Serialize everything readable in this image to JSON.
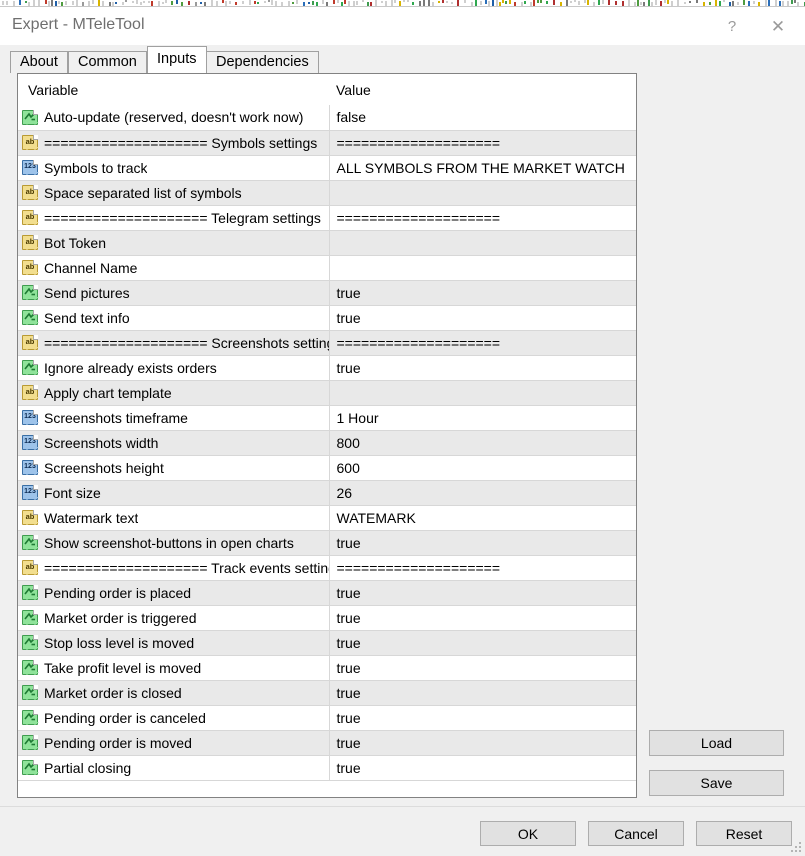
{
  "window": {
    "title": "Expert - MTeleTool",
    "help_label": "?",
    "close_label": "✕"
  },
  "tabs": [
    {
      "label": "About",
      "active": false
    },
    {
      "label": "Common",
      "active": false
    },
    {
      "label": "Inputs",
      "active": true
    },
    {
      "label": "Dependencies",
      "active": false
    }
  ],
  "table": {
    "headers": {
      "variable": "Variable",
      "value": "Value"
    },
    "rows": [
      {
        "icon": "bool-icon",
        "variable": "Auto-update (reserved, doesn't work now)",
        "value": "false"
      },
      {
        "icon": "string-icon",
        "variable": "==================== Symbols settings",
        "value": "===================="
      },
      {
        "icon": "int-icon",
        "variable": "Symbols to track",
        "value": "ALL SYMBOLS FROM THE MARKET WATCH"
      },
      {
        "icon": "string-icon",
        "variable": "Space separated list of symbols",
        "value": ""
      },
      {
        "icon": "string-icon",
        "variable": "==================== Telegram settings",
        "value": "===================="
      },
      {
        "icon": "string-icon",
        "variable": "Bot Token",
        "value": ""
      },
      {
        "icon": "string-icon",
        "variable": "Channel Name",
        "value": ""
      },
      {
        "icon": "bool-icon",
        "variable": "Send pictures",
        "value": "true"
      },
      {
        "icon": "bool-icon",
        "variable": "Send text info",
        "value": "true"
      },
      {
        "icon": "string-icon",
        "variable": "==================== Screenshots settings",
        "value": "===================="
      },
      {
        "icon": "bool-icon",
        "variable": "Ignore already exists orders",
        "value": "true"
      },
      {
        "icon": "string-icon",
        "variable": "Apply chart template",
        "value": ""
      },
      {
        "icon": "int-icon",
        "variable": "Screenshots timeframe",
        "value": "1 Hour"
      },
      {
        "icon": "int-icon",
        "variable": "Screenshots width",
        "value": "800"
      },
      {
        "icon": "int-icon",
        "variable": "Screenshots height",
        "value": "600"
      },
      {
        "icon": "int-icon",
        "variable": "Font size",
        "value": "26"
      },
      {
        "icon": "string-icon",
        "variable": "Watermark text",
        "value": "WATEMARK"
      },
      {
        "icon": "bool-icon",
        "variable": "Show screenshot-buttons in open charts",
        "value": "true"
      },
      {
        "icon": "string-icon",
        "variable": "==================== Track events settings",
        "value": "===================="
      },
      {
        "icon": "bool-icon",
        "variable": "Pending order is placed",
        "value": "true"
      },
      {
        "icon": "bool-icon",
        "variable": "Market order is triggered",
        "value": "true"
      },
      {
        "icon": "bool-icon",
        "variable": "Stop loss level is moved",
        "value": "true"
      },
      {
        "icon": "bool-icon",
        "variable": "Take profit level is moved",
        "value": "true"
      },
      {
        "icon": "bool-icon",
        "variable": "Market order is closed",
        "value": "true"
      },
      {
        "icon": "bool-icon",
        "variable": "Pending order is canceled",
        "value": "true"
      },
      {
        "icon": "bool-icon",
        "variable": "Pending order is moved",
        "value": "true"
      },
      {
        "icon": "bool-icon",
        "variable": "Partial closing",
        "value": "true"
      }
    ]
  },
  "side_buttons": {
    "load": "Load",
    "save": "Save"
  },
  "footer_buttons": {
    "ok": "OK",
    "cancel": "Cancel",
    "reset": "Reset"
  },
  "colors": {
    "dialog_bg": "#f0f0f0",
    "list_bg": "#ffffff",
    "row_alt_bg": "#e9e9e9",
    "grid_line": "#d7d7d7",
    "title_text": "#6f6f6f",
    "bool_icon": "#8fe39a",
    "string_icon": "#f2de8e",
    "int_icon": "#9dc3ea",
    "button_face": "#e1e1e1"
  }
}
